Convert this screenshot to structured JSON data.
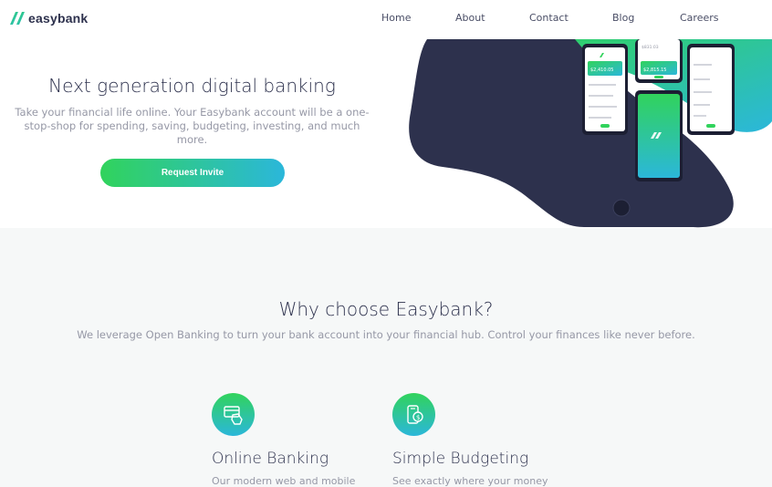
{
  "brand": {
    "name": "easybank"
  },
  "nav": {
    "items": [
      {
        "label": "Home"
      },
      {
        "label": "About"
      },
      {
        "label": "Contact"
      },
      {
        "label": "Blog"
      },
      {
        "label": "Careers"
      }
    ]
  },
  "hero": {
    "title": "Next generation digital banking",
    "subtitle": "Take your financial life online. Your Easybank account will be a one-stop-shop for spending, saving, budgeting, investing, and much more.",
    "cta_label": "Request Invite",
    "phone_screens": {
      "left_balance": "$2,410.05",
      "center_balance": "$2,815.15",
      "top_balance": "$831.03"
    }
  },
  "why": {
    "title": "Why choose Easybank?",
    "subtitle": "We leverage Open Banking to turn your bank account into your financial hub. Control your finances like never before.",
    "features": [
      {
        "title": "Online Banking",
        "desc": "Our modern web and mobile",
        "icon": "online-banking-icon"
      },
      {
        "title": "Simple Budgeting",
        "desc": "See exactly where your money",
        "icon": "budgeting-icon"
      }
    ]
  },
  "colors": {
    "dark_blue": "#2d314d",
    "lime_green": "#31d35c",
    "bright_cyan": "#2bb7da",
    "grayish_blue": "#9698a6",
    "light_grayish_blue": "#f6f8f8"
  }
}
